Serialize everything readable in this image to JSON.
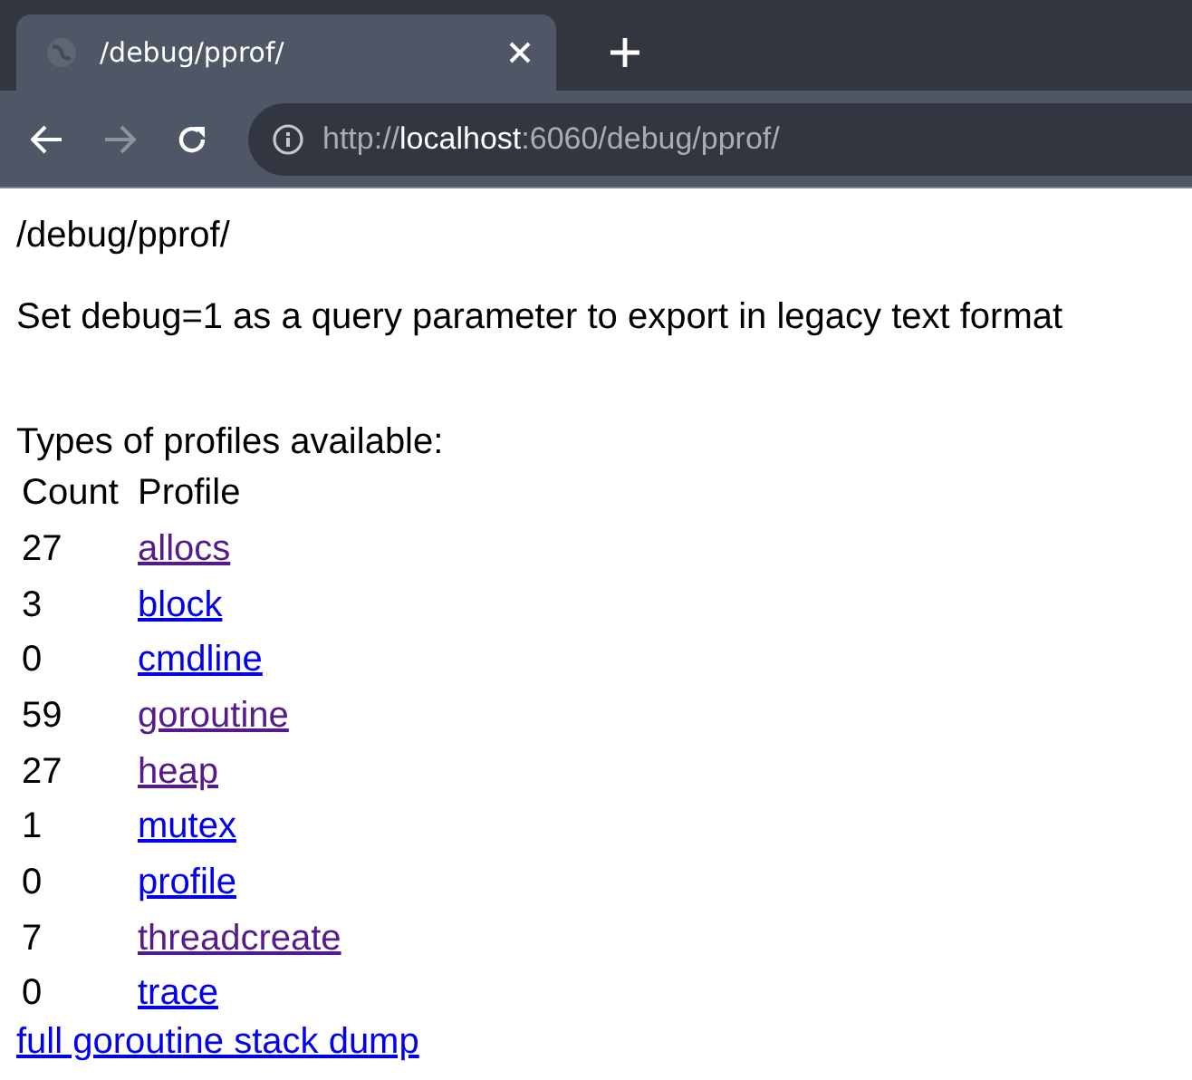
{
  "tab": {
    "title": "/debug/pprof/"
  },
  "address_bar": {
    "url": "http://**localhost**:6060/debug/pprof/"
  },
  "page": {
    "heading": "/debug/pprof/",
    "note": "Set debug=1 as a query parameter to export in legacy text format",
    "types_label": "Types of profiles available:",
    "table": {
      "columns": [
        "Count",
        "Profile"
      ],
      "rows": [
        {
          "count": "27",
          "profile": "allocs",
          "visited": true
        },
        {
          "count": "3",
          "profile": "block",
          "visited": false
        },
        {
          "count": "0",
          "profile": "cmdline",
          "visited": false
        },
        {
          "count": "59",
          "profile": "goroutine",
          "visited": true
        },
        {
          "count": "27",
          "profile": "heap",
          "visited": true
        },
        {
          "count": "1",
          "profile": "mutex",
          "visited": false
        },
        {
          "count": "0",
          "profile": "profile",
          "visited": false
        },
        {
          "count": "7",
          "profile": "threadcreate",
          "visited": true
        },
        {
          "count": "0",
          "profile": "trace",
          "visited": false
        }
      ]
    },
    "footer_link": {
      "text": "full goroutine stack dump",
      "visited": false
    }
  }
}
